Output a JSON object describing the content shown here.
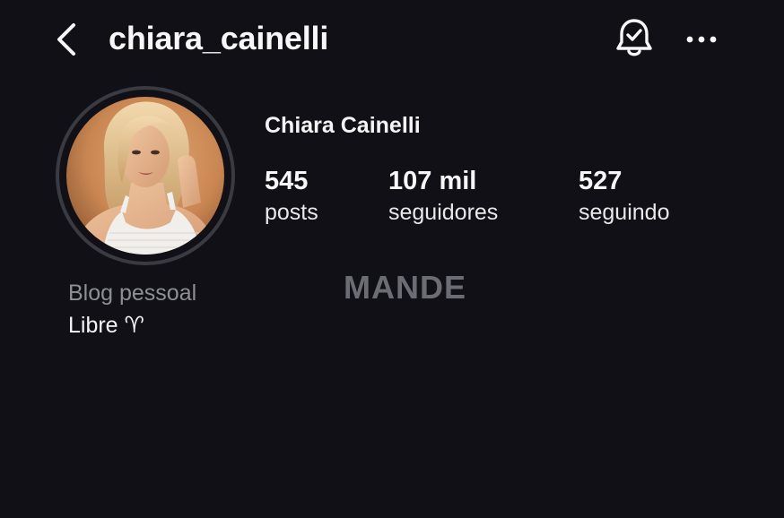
{
  "header": {
    "username": "chiara_cainelli",
    "back_icon": "chevron-left-icon",
    "notification_icon": "bell-check-icon",
    "more_icon": "more-horizontal-icon"
  },
  "profile": {
    "display_name": "Chiara Cainelli",
    "stats": [
      {
        "value": "545",
        "label": "posts"
      },
      {
        "value": "107 mil",
        "label": "seguidores"
      },
      {
        "value": "527",
        "label": "seguindo"
      }
    ],
    "category": "Blog pessoal",
    "bio": "Libre ♈︎"
  },
  "watermark": "MANDE",
  "colors": {
    "background": "#101016",
    "text_primary": "#f4f4f6",
    "text_secondary": "#8e8f96",
    "avatar_ring": "#3a3b42",
    "watermark": "#6c6d74"
  }
}
